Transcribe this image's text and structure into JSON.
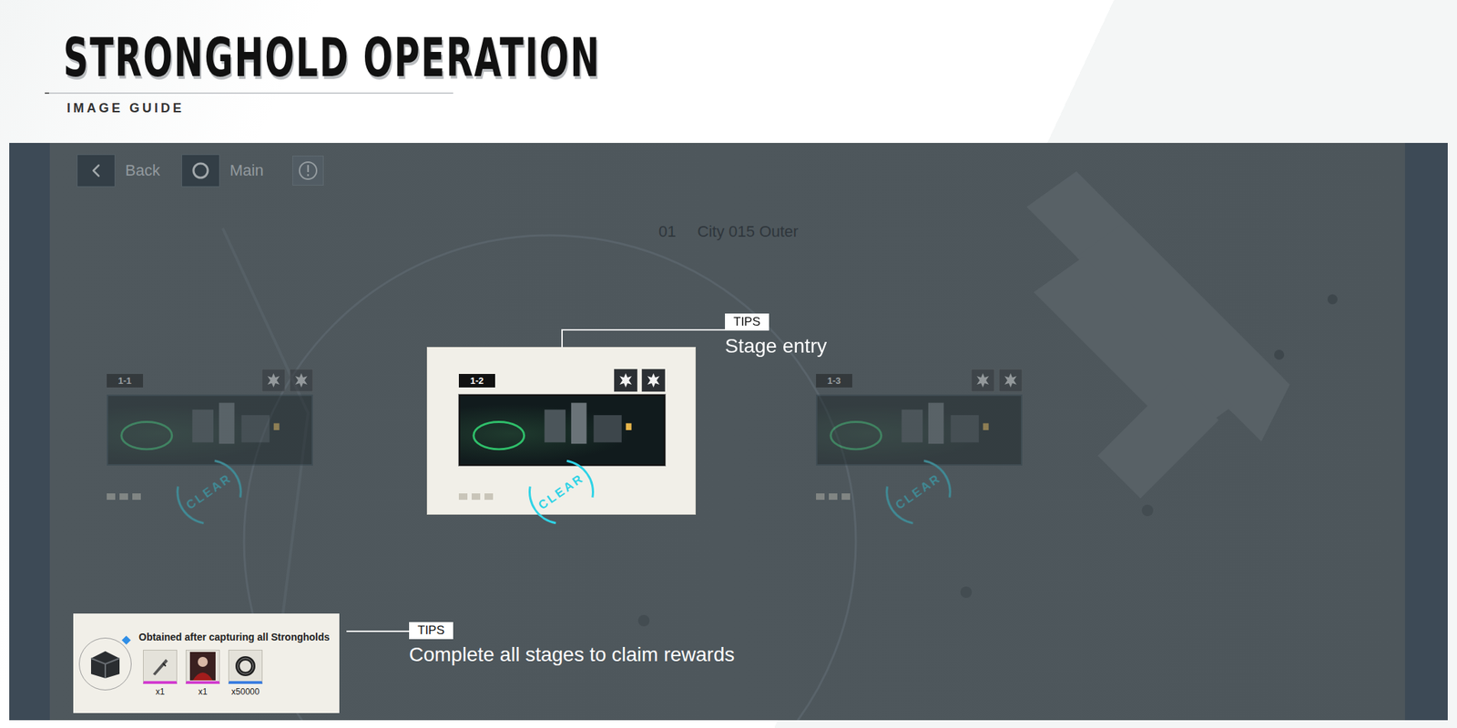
{
  "header": {
    "title": "STRONGHOLD OPERATION",
    "subtitle": "IMAGE GUIDE"
  },
  "topbar": {
    "buttons": [
      {
        "label": "Back",
        "kind": "back"
      },
      {
        "label": "Main",
        "kind": "main"
      }
    ]
  },
  "area": {
    "number": "01",
    "name": "City 015 Outer"
  },
  "stages": [
    {
      "label": "1-1",
      "status": "CLEAR",
      "highlighted": false
    },
    {
      "label": "1-2",
      "status": "CLEAR",
      "highlighted": true
    },
    {
      "label": "1-3",
      "status": "CLEAR",
      "highlighted": false
    }
  ],
  "tips": [
    {
      "badge": "TIPS",
      "text": "Stage entry"
    },
    {
      "badge": "TIPS",
      "text": "Complete all stages to claim rewards"
    }
  ],
  "rewards": {
    "title": "Obtained after capturing all Strongholds",
    "items": [
      {
        "quantity": "x1",
        "color": "#d23fcf",
        "kind": "weapon"
      },
      {
        "quantity": "x1",
        "color": "#d23fcf",
        "kind": "portrait"
      },
      {
        "quantity": "x50000",
        "color": "#3d7fe0",
        "kind": "ring"
      }
    ]
  }
}
